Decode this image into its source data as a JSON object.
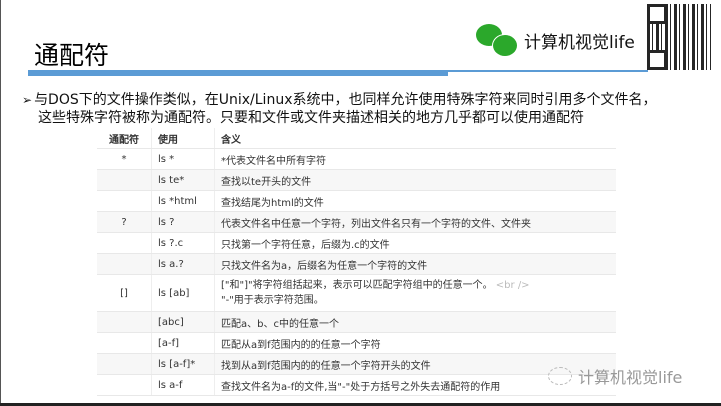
{
  "slide": {
    "title": "通配符",
    "intro_line1": "与DOS下的文件操作类似，在Unix/Linux系统中，也同样允许使用特殊字符来同时引用多个文件名，",
    "intro_line2": "这些特殊字符被称为通配符。只要和文件或文件夹描述相关的地方几乎都可以使用通配符"
  },
  "logo": {
    "text": "计算机视觉life",
    "color": "#2ba82b"
  },
  "watermark": {
    "text": "计算机视觉life"
  },
  "table": {
    "headers": [
      "通配符",
      "使用",
      "含义"
    ],
    "rows": [
      [
        "*",
        "ls *",
        "*代表文件名中所有字符"
      ],
      [
        "",
        "ls te*",
        "查找以te开头的文件"
      ],
      [
        "",
        "ls *html",
        "查找结尾为html的文件"
      ],
      [
        "?",
        "ls ?",
        "代表文件名中任意一个字符，列出文件名只有一个字符的文件、文件夹"
      ],
      [
        "",
        "ls ?.c",
        "只找第一个字符任意，后缀为.c的文件"
      ],
      [
        "",
        "ls a.?",
        "只找文件名为a，后缀名为任意一个字符的文件"
      ],
      [
        "[]",
        "ls [ab]",
        "[\"和\"]\"将字符组括起来，表示可以匹配字符组中的任意一个。",
        "<br />",
        "\"-\"用于表示字符范围。"
      ],
      [
        "",
        "[abc]",
        "匹配a、b、c中的任意一个"
      ],
      [
        "",
        "[a-f]",
        "匹配从a到f范围内的的任意一个字符"
      ],
      [
        "",
        "ls [a-f]*",
        "找到从a到f范围内的的任意一个字符开头的文件"
      ],
      [
        "",
        "ls a-f",
        "查找文件名为a-f的文件,当\"-\"处于方括号之外失去通配符的作用"
      ]
    ]
  },
  "colors": {
    "accent": "#5b9bd5"
  }
}
